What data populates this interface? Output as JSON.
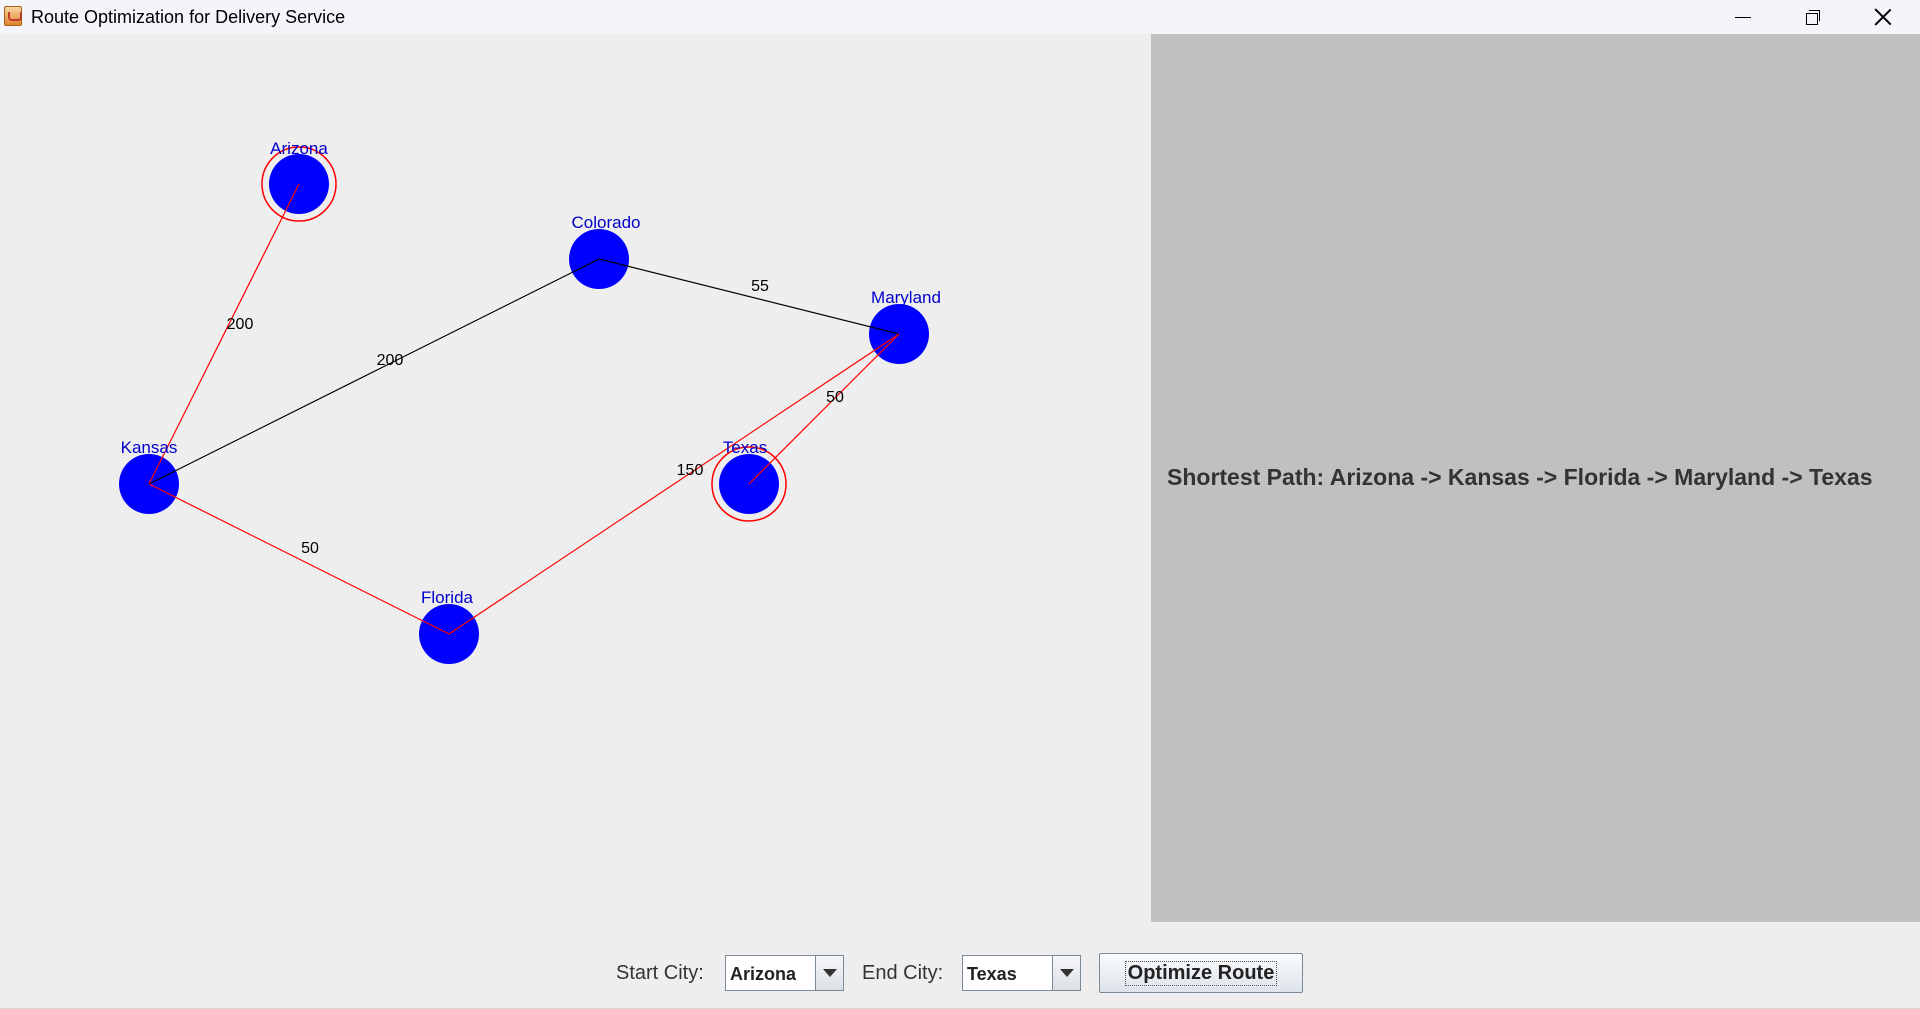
{
  "window": {
    "title": "Route Optimization for Delivery Service"
  },
  "graph": {
    "node_color": "#0000ff",
    "label_color": "#0000cc",
    "highlight_color": "#ff0000",
    "edge_color": "#000000",
    "nodes": [
      {
        "id": "arizona",
        "label": "Arizona",
        "highlighted": true
      },
      {
        "id": "colorado",
        "label": "Colorado",
        "highlighted": false
      },
      {
        "id": "maryland",
        "label": "Maryland",
        "highlighted": false
      },
      {
        "id": "kansas",
        "label": "Kansas",
        "highlighted": false
      },
      {
        "id": "texas",
        "label": "Texas",
        "highlighted": true
      },
      {
        "id": "florida",
        "label": "Florida",
        "highlighted": false
      }
    ],
    "edges": [
      {
        "from": "arizona",
        "to": "kansas",
        "weight": "200",
        "on_path": true
      },
      {
        "from": "kansas",
        "to": "colorado",
        "weight": "200",
        "on_path": false
      },
      {
        "from": "colorado",
        "to": "maryland",
        "weight": "55",
        "on_path": false
      },
      {
        "from": "maryland",
        "to": "texas",
        "weight": "50",
        "on_path": true
      },
      {
        "from": "kansas",
        "to": "florida",
        "weight": "50",
        "on_path": true
      },
      {
        "from": "florida",
        "to": "maryland",
        "weight": "150",
        "on_path": true
      }
    ]
  },
  "result": {
    "text": "Shortest Path: Arizona -> Kansas -> Florida -> Maryland -> Texas"
  },
  "controls": {
    "start_label": "Start City:",
    "start_value": "Arizona",
    "end_label": "End City:",
    "end_value": "Texas",
    "optimize_label": "Optimize Route"
  }
}
